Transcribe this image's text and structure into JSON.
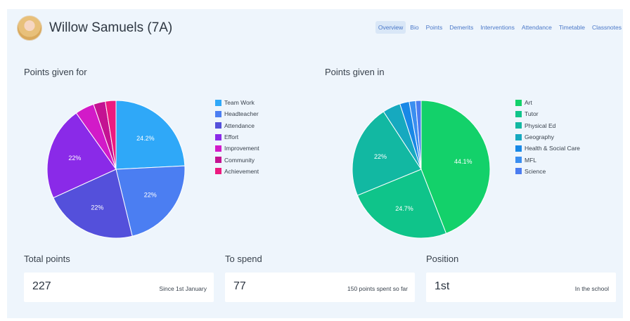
{
  "student": {
    "name": "Willow Samuels (7A)"
  },
  "nav": {
    "items": [
      "Overview",
      "Bio",
      "Points",
      "Demerits",
      "Interventions",
      "Attendance",
      "Timetable",
      "Classnotes"
    ],
    "active": "Overview"
  },
  "sections": {
    "points_for_title": "Points given for",
    "points_in_title": "Points given in"
  },
  "chart_data": [
    {
      "type": "pie",
      "title": "Points given for",
      "slices": [
        {
          "label": "Team Work",
          "value": 24.2,
          "color": "#2fa8f8",
          "data_label": "24.2%"
        },
        {
          "label": "Headteacher",
          "value": 22,
          "color": "#4b7ef2",
          "data_label": "22%"
        },
        {
          "label": "Attendance",
          "value": 22,
          "color": "#5450db",
          "data_label": "22%"
        },
        {
          "label": "Effort",
          "value": 22,
          "color": "#8a2ae8",
          "data_label": "22%"
        },
        {
          "label": "Improvement",
          "value": 4.5,
          "color": "#d21ac8",
          "data_label": ""
        },
        {
          "label": "Community",
          "value": 2.8,
          "color": "#c41292",
          "data_label": ""
        },
        {
          "label": "Achievement",
          "value": 2.5,
          "color": "#ec1a80",
          "data_label": ""
        }
      ]
    },
    {
      "type": "pie",
      "title": "Points given in",
      "slices": [
        {
          "label": "Art",
          "value": 44.1,
          "color": "#13d16a",
          "data_label": "44.1%"
        },
        {
          "label": "Tutor",
          "value": 24.7,
          "color": "#0fc48a",
          "data_label": "24.7%"
        },
        {
          "label": "Physical Ed",
          "value": 22,
          "color": "#12b8a2",
          "data_label": "22%"
        },
        {
          "label": "Geography",
          "value": 4.2,
          "color": "#16a9bf",
          "data_label": ""
        },
        {
          "label": "Health & Social Care",
          "value": 2.2,
          "color": "#1888e6",
          "data_label": ""
        },
        {
          "label": "MFL",
          "value": 1.5,
          "color": "#3a8ef0",
          "data_label": ""
        },
        {
          "label": "Science",
          "value": 1.3,
          "color": "#4a7cf0",
          "data_label": ""
        }
      ]
    }
  ],
  "stats": {
    "total": {
      "label": "Total points",
      "value": "227",
      "note": "Since 1st January"
    },
    "spend": {
      "label": "To spend",
      "value": "77",
      "note": "150 points spent so far"
    },
    "position": {
      "label": "Position",
      "value": "1st",
      "note": "In the school"
    }
  }
}
